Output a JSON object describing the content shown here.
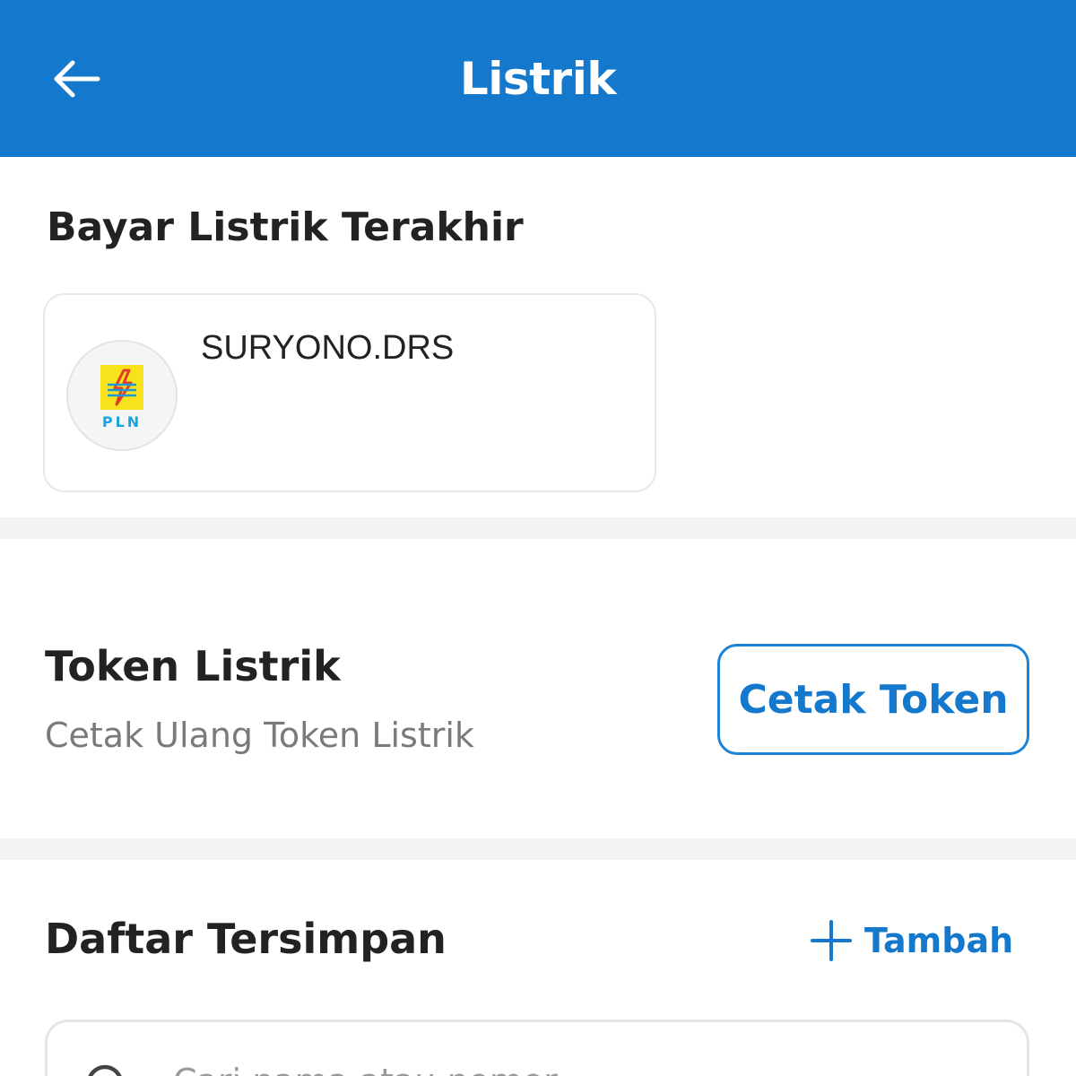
{
  "header": {
    "title": "Listrik",
    "back_icon": "arrow-left-icon",
    "background_color": "#1479cd"
  },
  "recent": {
    "title": "Bayar Listrik Terakhir",
    "card": {
      "name": "SURYONO.DRS",
      "provider_logo_text": "PLN",
      "provider_icon": "pln-logo-icon"
    }
  },
  "token": {
    "title": "Token Listrik",
    "subtitle": "Cetak Ulang Token Listrik",
    "button_label": "Cetak Token"
  },
  "saved": {
    "title": "Daftar Tersimpan",
    "add_label": "Tambah",
    "add_icon": "plus-icon",
    "search": {
      "icon": "search-icon",
      "placeholder": "Cari nama atau nomor"
    }
  },
  "colors": {
    "accent": "#1479cd",
    "subtle_text": "#7a7a7a",
    "divider": "#f2f3f5"
  }
}
